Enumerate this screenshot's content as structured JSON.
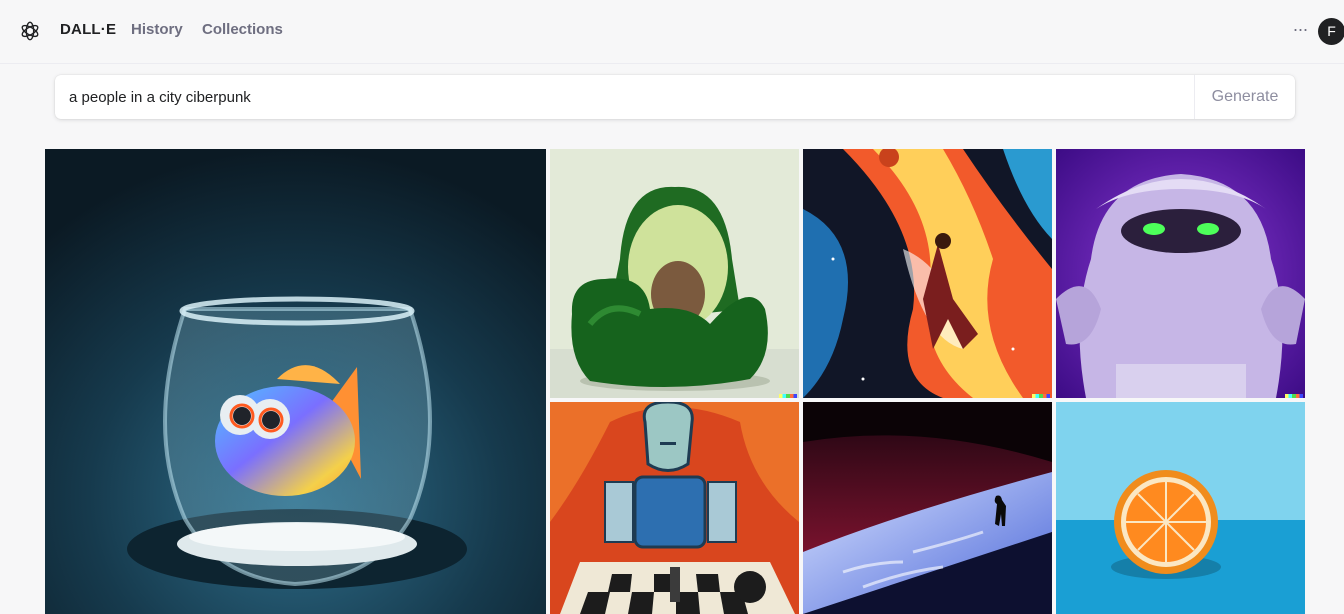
{
  "nav": {
    "logo_icon": "openai-logo-icon",
    "brand": "DALL·E",
    "history": "History",
    "collections": "Collections",
    "more_icon": "more-horizontal-icon",
    "more_glyph": "···",
    "avatar_initial": "F"
  },
  "prompt": {
    "value": "a people in a city ciberpunk",
    "generate_label": "Generate"
  },
  "gallery": {
    "items": [
      {
        "name": "goldfish-bowl-image"
      },
      {
        "name": "avocado-armchair-image"
      },
      {
        "name": "space-basketball-image"
      },
      {
        "name": "purple-monster-image"
      },
      {
        "name": "robot-chess-image"
      },
      {
        "name": "dune-silhouette-image"
      },
      {
        "name": "orange-half-image"
      }
    ]
  },
  "colors": {
    "background": "#f7f7f8",
    "text": "#202123",
    "muted": "#6e6e80",
    "avatar_bg": "#202123"
  }
}
